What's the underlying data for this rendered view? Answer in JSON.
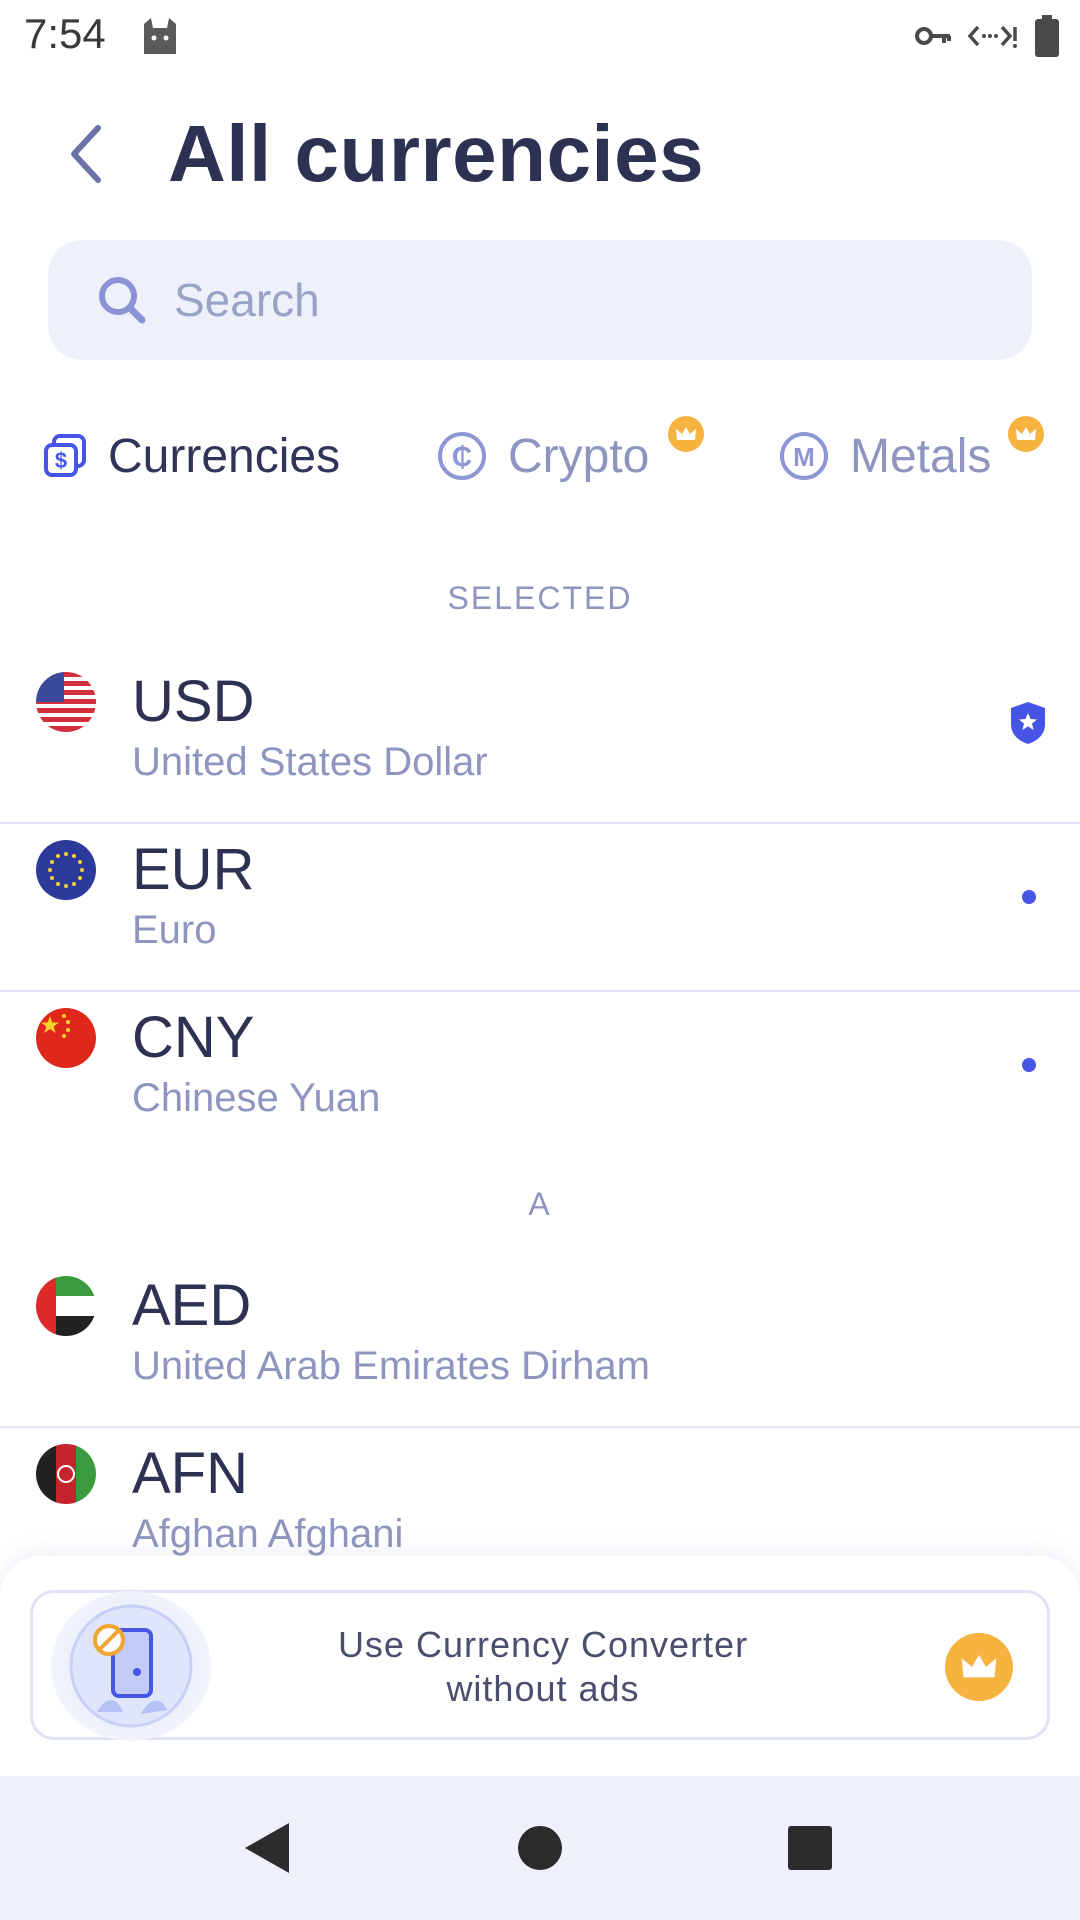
{
  "status_bar": {
    "time": "7:54"
  },
  "header": {
    "title": "All currencies",
    "back_label": "Back"
  },
  "search": {
    "placeholder": "Search",
    "value": ""
  },
  "tabs": [
    {
      "label": "Currencies",
      "active": true,
      "premium": false
    },
    {
      "label": "Crypto",
      "active": false,
      "premium": true
    },
    {
      "label": "Metals",
      "active": false,
      "premium": true
    }
  ],
  "sections": {
    "selected": "SELECTED",
    "a": "A"
  },
  "selected_currencies": [
    {
      "code": "USD",
      "name": "United States Dollar",
      "marker": "shield-star"
    },
    {
      "code": "EUR",
      "name": "Euro",
      "marker": "dot"
    },
    {
      "code": "CNY",
      "name": "Chinese Yuan",
      "marker": "dot"
    }
  ],
  "a_currencies": [
    {
      "code": "AED",
      "name": "United Arab Emirates Dirham"
    },
    {
      "code": "AFN",
      "name": "Afghan Afghani"
    }
  ],
  "ad_banner": {
    "text_line1": "Use Currency Converter",
    "text_line2": "without ads"
  },
  "colors": {
    "accent": "#4755e6",
    "title": "#2d3152",
    "muted": "#8e96bf",
    "premium": "#f6b33f",
    "search_bg": "#eef1fc"
  }
}
